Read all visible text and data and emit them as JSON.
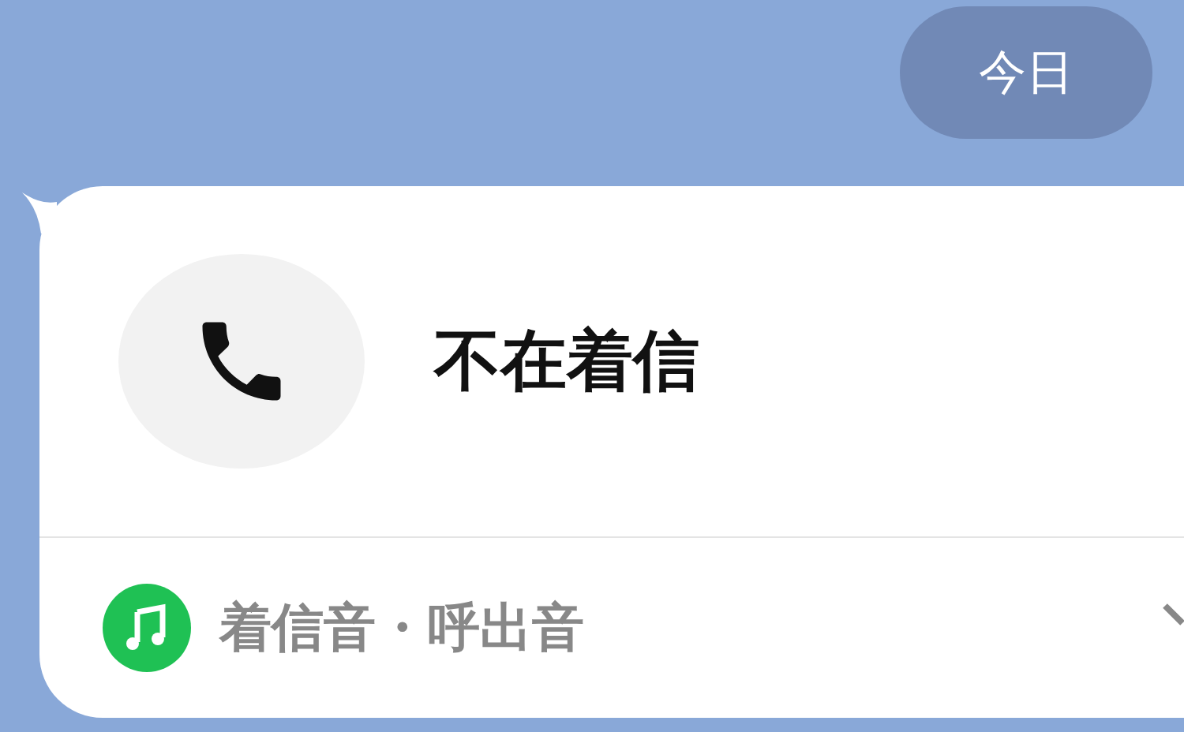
{
  "date_badge": "今日",
  "call_card": {
    "title": "不在着信",
    "footer": {
      "label": "着信音・呼出音"
    }
  }
}
